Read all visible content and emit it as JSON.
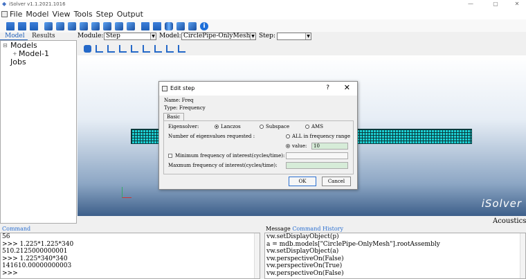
{
  "window": {
    "title": "iSolver v1.1.2021.1016",
    "controls": {
      "minimize": "—",
      "maximize": "▢",
      "close": "✕"
    }
  },
  "menu": [
    "File",
    "Model",
    "View",
    "Tools",
    "Step",
    "Output"
  ],
  "left_tabs": {
    "model": "Model",
    "results": "Results"
  },
  "module_bar": {
    "module_label": "Module:",
    "module_value": "Step",
    "model_label": "Model:",
    "model_value": "CirclePipe-OnlyMesh",
    "step_label": "Step:",
    "step_value": ""
  },
  "tree": {
    "models": "Models",
    "model1": "Model-1",
    "jobs": "Jobs"
  },
  "viewport": {
    "brand": "iSolver"
  },
  "status": {
    "acoustics": "Acoustics"
  },
  "dialog": {
    "title": "Edit step",
    "help": "?",
    "close": "✕",
    "name_line": "Name: Freq",
    "type_line": "Type: Frequency",
    "tab_basic": "Basic",
    "eigensolver_label": "Eigensolver:",
    "solver_lanczos": "Lanczos",
    "solver_subspace": "Subspace",
    "solver_ams": "AMS",
    "eigen_requested_label": "Number of eigenvalues requested :",
    "opt_all": "ALL in frequency range",
    "opt_value": "value:",
    "value": "10",
    "min_freq_label": "Minimum frequency of interest(cycles/time):",
    "max_freq_label": "Maxmum frequency of interest(cycles/time):",
    "ok": "OK",
    "cancel": "Cancel"
  },
  "command": {
    "label": "Command",
    "lines": [
      "56",
      ">>> 1.225*1.225*340",
      "510.2125000000001",
      ">>> 1.225*340*340",
      "141610.00000000003",
      ">>>"
    ]
  },
  "message": {
    "label": "Message",
    "history_label": "Command History",
    "lines": [
      "vw.setDisplayObject(p)",
      "a = mdb.models[\"CirclePipe-OnlyMesh\"].rootAssembly",
      "vw.setDisplayObject(a)",
      "vw.perspectiveOn(False)",
      "vw.perspectiveOn(True)",
      "vw.perspectiveOn(False)"
    ]
  }
}
